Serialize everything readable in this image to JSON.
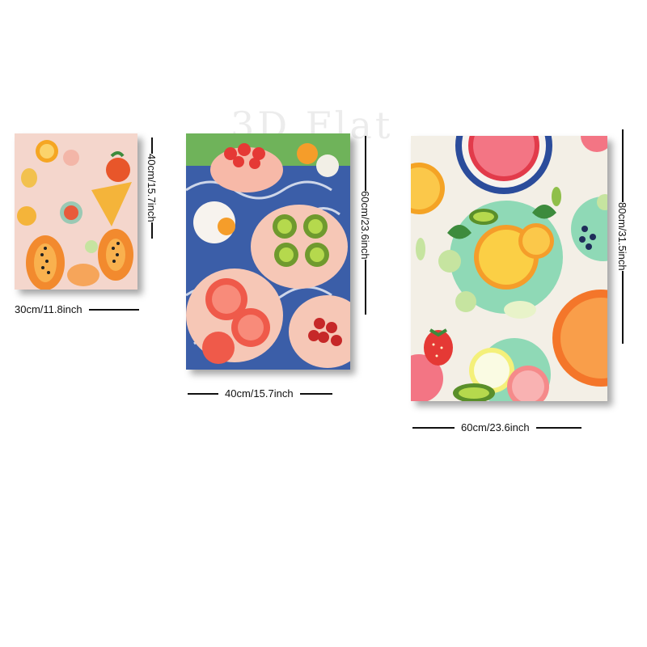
{
  "watermark": "3D Flat",
  "posters": [
    {
      "theme": "papaya-and-citrus",
      "width_label": "30cm/11.8inch",
      "height_label": "40cm/15.7inch"
    },
    {
      "theme": "kiwi-grapefruit-strawberry",
      "width_label": "40cm/15.7inch",
      "height_label": "60cm/23.6inch"
    },
    {
      "theme": "citrus-plates",
      "width_label": "60cm/23.6inch",
      "height_label": "80cm/31.5inch"
    }
  ],
  "colors": {
    "ink": "#111111",
    "peach": "#f6d2c2",
    "blue": "#3b5ea8",
    "mint": "#8fd9b6"
  }
}
